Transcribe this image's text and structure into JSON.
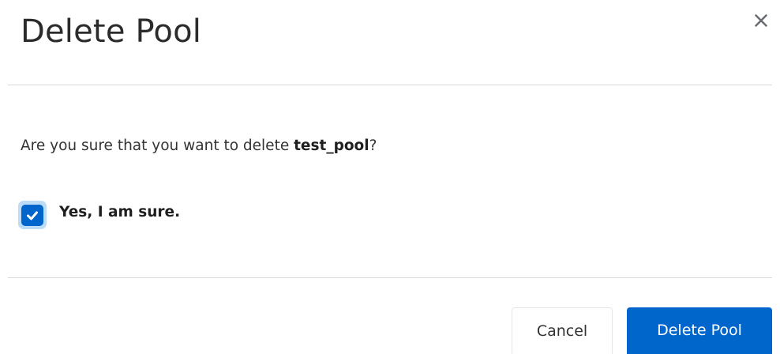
{
  "dialog": {
    "title": "Delete Pool",
    "close_icon": "close-icon",
    "question_prefix": "Are you sure that you want to delete ",
    "pool_name": "test_pool",
    "question_suffix": "?",
    "confirm_checkbox": {
      "label": "Yes, I am sure.",
      "checked": true,
      "icon": "checkmark-icon"
    },
    "buttons": {
      "cancel_label": "Cancel",
      "delete_label": "Delete Pool"
    }
  },
  "colors": {
    "primary": "#0066cc",
    "focus_ring": "#bcdcf8",
    "divider": "#d7dadc",
    "text": "#333333"
  }
}
